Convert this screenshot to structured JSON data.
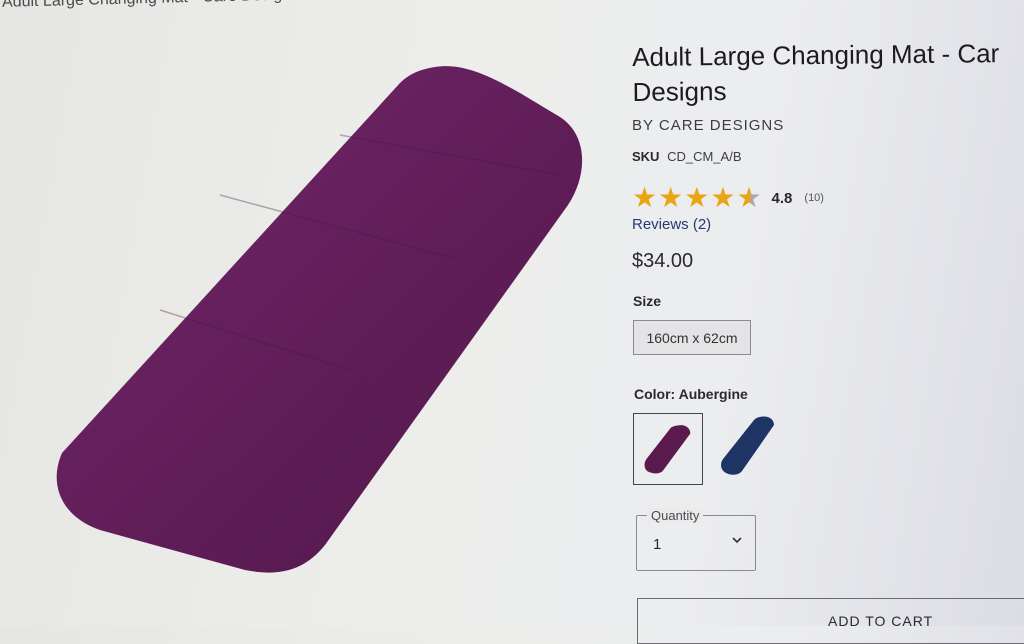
{
  "breadcrumb": {
    "text": "Adult Large Changing Mat - Care Designs"
  },
  "product": {
    "title_line1": "Adult Large Changing Mat - Car",
    "title_line2": "Designs",
    "brand": "BY CARE DESIGNS",
    "sku_label": "SKU",
    "sku_value": "CD_CM_A/B",
    "rating": {
      "stars_filled_fraction": 0.96,
      "value": "4.8",
      "count": "(10)",
      "star_color": "#e9a514"
    },
    "reviews_link": "Reviews (2)",
    "price": "$34.00",
    "size": {
      "label": "Size",
      "options": [
        "160cm x 62cm"
      ]
    },
    "color": {
      "label": "Color: Aubergine",
      "swatches": [
        {
          "name": "Aubergine",
          "hex": "#5a1a4e",
          "selected": true
        },
        {
          "name": "Navy",
          "hex": "#1e3464",
          "selected": false
        }
      ]
    },
    "quantity": {
      "label": "Quantity",
      "value": "1"
    },
    "add_to_cart_label": "ADD TO CART"
  },
  "colors": {
    "mat_primary": "#5e1d56",
    "link": "#243b72"
  }
}
